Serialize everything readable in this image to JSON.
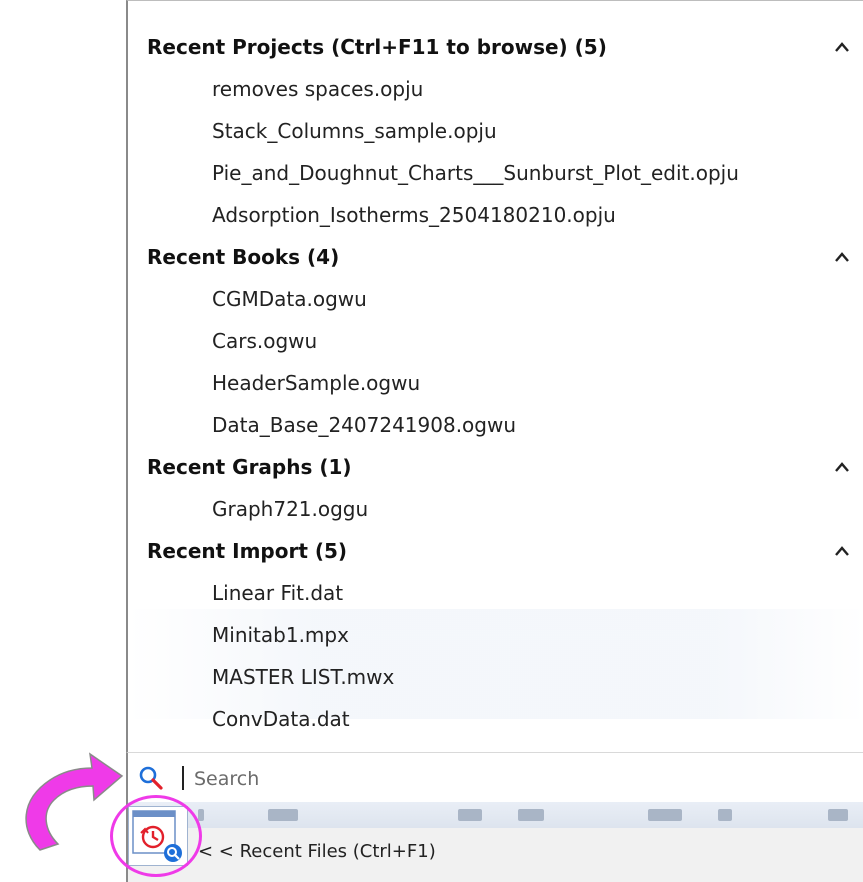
{
  "recent_menu": {
    "groups": [
      {
        "title": "Recent Projects (Ctrl+F11 to browse) (5)",
        "items": [
          "removes spaces.opju",
          "Stack_Columns_sample.opju",
          "Pie_and_Doughnut_Charts___Sunburst_Plot_edit.opju",
          "Adsorption_Isotherms_2504180210.opju"
        ]
      },
      {
        "title": "Recent Books (4)",
        "items": [
          "CGMData.ogwu",
          "Cars.ogwu",
          "HeaderSample.ogwu",
          "Data_Base_2407241908.ogwu"
        ]
      },
      {
        "title": "Recent Graphs (1)",
        "items": [
          "Graph721.oggu"
        ]
      },
      {
        "title": "Recent Import (5)",
        "items": [
          "Linear Fit.dat",
          "Minitab1.mpx",
          "MASTER LIST.mwx",
          "ConvData.dat"
        ]
      }
    ]
  },
  "search": {
    "placeholder": "Search",
    "value": "",
    "icon": "search-icon"
  },
  "status_bar": {
    "label": "< < Recent Files (Ctrl+F1)"
  },
  "colors": {
    "highlight": "#ef3ae8",
    "search_icon": "#1e6fd9",
    "clock_icon": "#e2202b"
  }
}
